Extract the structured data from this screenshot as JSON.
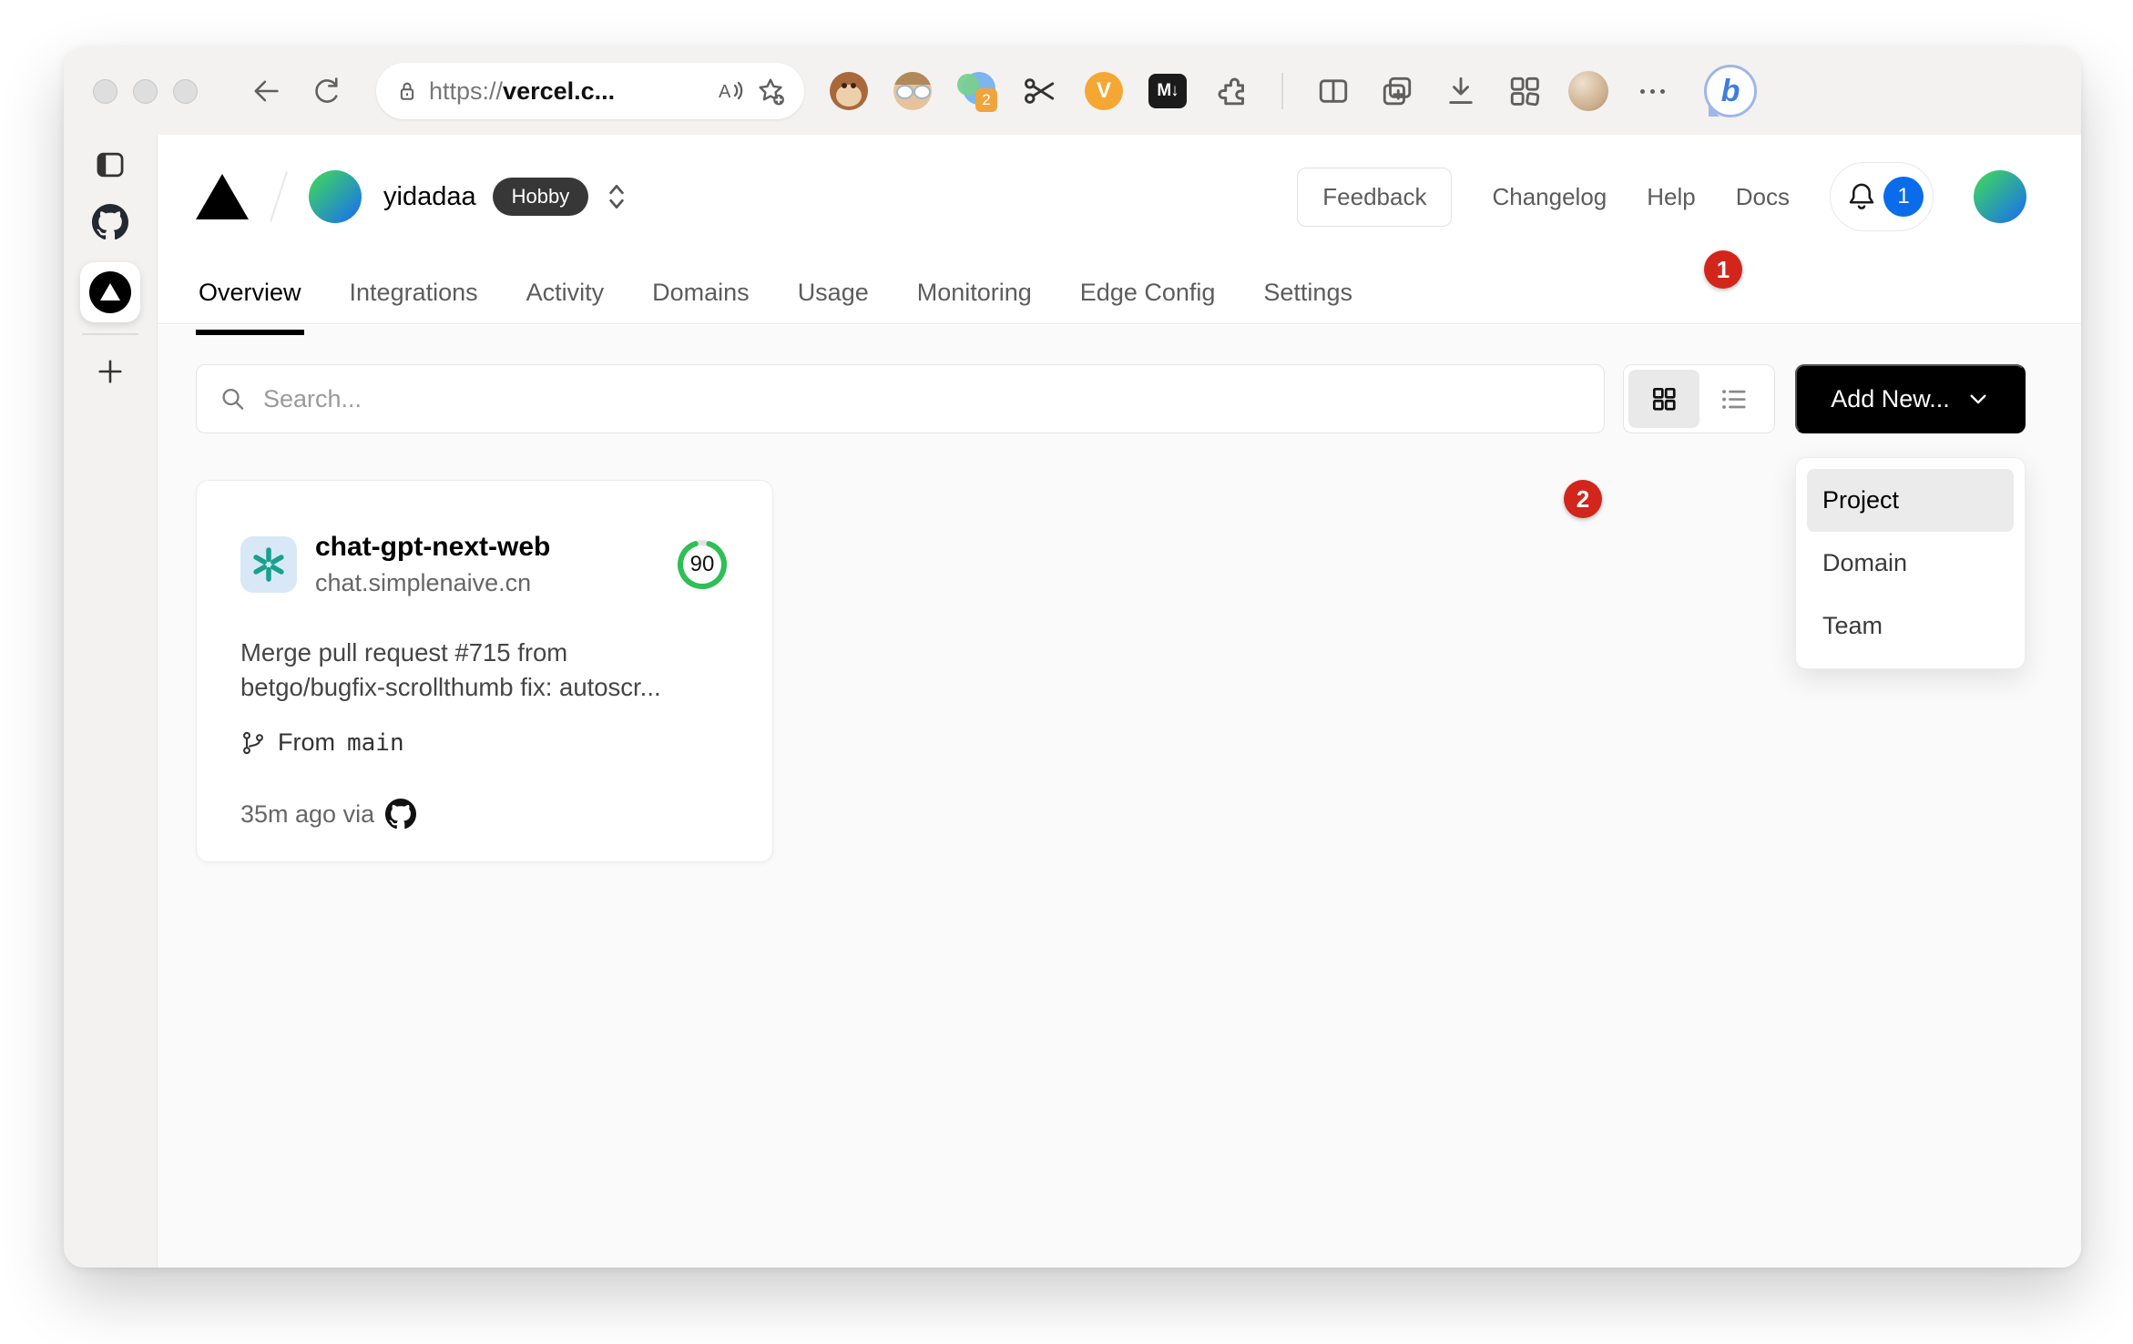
{
  "browser": {
    "url_prefix": "https://",
    "url_host": "vercel.c...",
    "translate_badge": "2",
    "v_ext_label": "V",
    "markdown_ext_label": "M↓",
    "bing_label": "b"
  },
  "header": {
    "team_name": "yidadaa",
    "plan_badge": "Hobby",
    "feedback_label": "Feedback",
    "links": [
      "Changelog",
      "Help",
      "Docs"
    ],
    "notification_count": "1"
  },
  "nav": {
    "tabs": [
      "Overview",
      "Integrations",
      "Activity",
      "Domains",
      "Usage",
      "Monitoring",
      "Edge Config",
      "Settings"
    ],
    "active_tab": "Overview"
  },
  "content": {
    "search_placeholder": "Search...",
    "add_new_label": "Add New..."
  },
  "add_new_menu": {
    "items": [
      "Project",
      "Domain",
      "Team"
    ],
    "highlighted": "Project"
  },
  "project_card": {
    "name": "chat-gpt-next-web",
    "domain": "chat.simplenaive.cn",
    "score": "90",
    "commit_lines": [
      "Merge pull request #715 from",
      "betgo/bugfix-scrollthumb fix: autoscr..."
    ],
    "branch_label": "From",
    "branch_name": "main",
    "deployed_meta": "35m ago via"
  },
  "annotations": {
    "step_1": "1",
    "step_2": "2"
  },
  "colors": {
    "annotation_red": "#d2251b",
    "score_green": "#2fbf55",
    "notification_blue": "#0a6ceb",
    "add_new_black": "#000000",
    "page_bg": "#fafafa",
    "chrome_bg": "#f4f2f1"
  }
}
